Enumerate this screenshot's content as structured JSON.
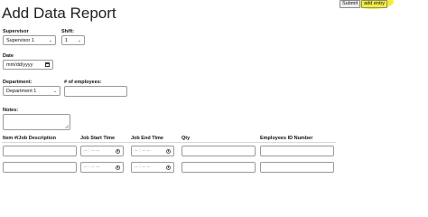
{
  "page": {
    "title": "Add Data Report"
  },
  "actions": {
    "submit_label": "Submit",
    "add_entry_label": "add entry",
    "highlight_color": "#f2ee3a"
  },
  "form": {
    "supervisor": {
      "label": "Supervisor",
      "value": "Supervisor 1"
    },
    "shift": {
      "label": "Shift:",
      "value": "1"
    },
    "date": {
      "label": "Date",
      "placeholder": "mm/dd/yyyy"
    },
    "department": {
      "label": "Department:",
      "value": "Department 1"
    },
    "employees": {
      "label": "# of employees:",
      "value": ""
    },
    "notes": {
      "label": "Notes:",
      "value": ""
    }
  },
  "table": {
    "headers": [
      "Item #/Job Description",
      "Job Start Time",
      "Job End Time",
      "Qty",
      "Employees ID Number"
    ],
    "time_placeholder": "-- : -- --",
    "rows": [
      {
        "item": "",
        "start": "",
        "end": "",
        "qty": "",
        "employees": ""
      },
      {
        "item": "",
        "start": "",
        "end": "",
        "qty": "",
        "employees": ""
      }
    ]
  }
}
